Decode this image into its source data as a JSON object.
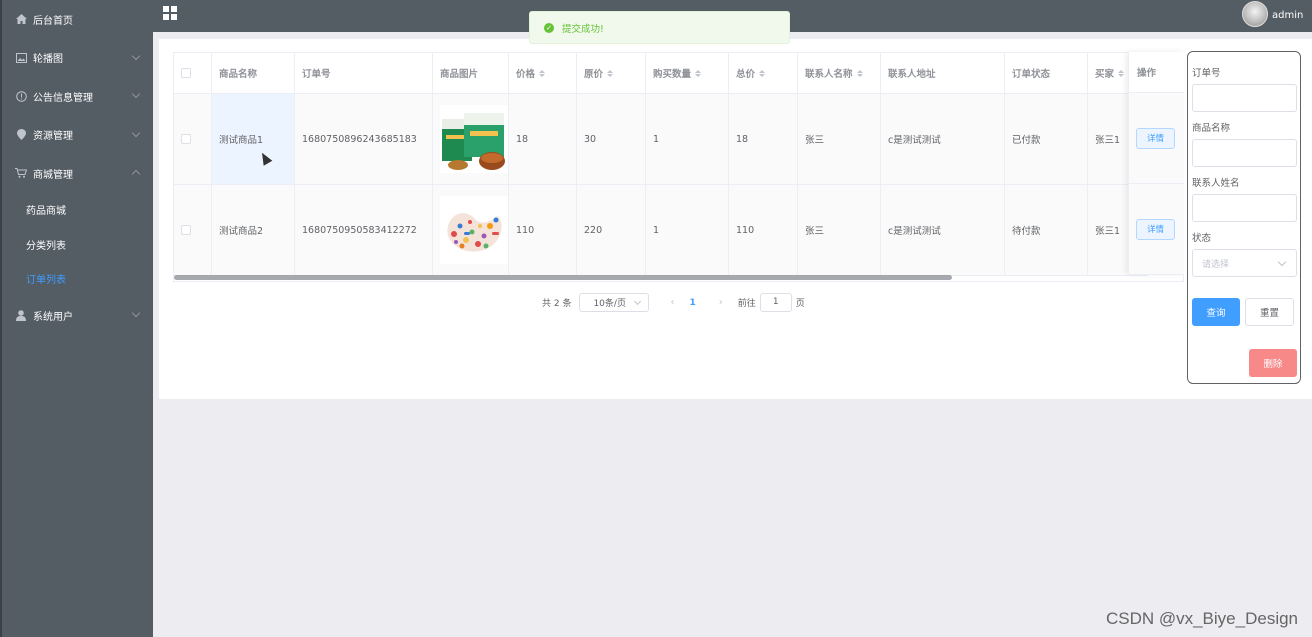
{
  "header": {
    "title": "",
    "user": "admin"
  },
  "toast": {
    "message": "提交成功!"
  },
  "sidebar": {
    "items": [
      {
        "label": "后台首页",
        "icon": "home-icon"
      },
      {
        "label": "轮播图",
        "icon": "image-icon"
      },
      {
        "label": "公告信息管理",
        "icon": "info-icon"
      },
      {
        "label": "资源管理",
        "icon": "location-icon"
      },
      {
        "label": "商城管理",
        "icon": "cart-icon"
      },
      {
        "label": "系统用户",
        "icon": "user-icon"
      }
    ],
    "subitems": [
      {
        "label": "药品商城",
        "active": false
      },
      {
        "label": "分类列表",
        "active": false
      },
      {
        "label": "订单列表",
        "active": true
      }
    ]
  },
  "table": {
    "headers": [
      "商品名称",
      "订单号",
      "商品图片",
      "价格",
      "原价",
      "购买数量",
      "总价",
      "联系人名称",
      "联系人地址",
      "订单状态",
      "买家",
      "操作"
    ],
    "rows": [
      {
        "name": "测试商品1",
        "order_no": "1680750896243685183",
        "price": "18",
        "original": "30",
        "qty": "1",
        "total": "18",
        "contact": "张三",
        "address": "c是测试测试",
        "status": "已付款",
        "buyer": "张三1",
        "action": "详情"
      },
      {
        "name": "测试商品2",
        "order_no": "1680750950583412272",
        "price": "110",
        "original": "220",
        "qty": "1",
        "total": "110",
        "contact": "张三",
        "address": "c是测试测试",
        "status": "待付款",
        "buyer": "张三1",
        "action": "详情"
      }
    ]
  },
  "pagination": {
    "total": "共 2 条",
    "page_size": "10条/页",
    "current": "1",
    "goto_prefix": "前往",
    "goto_value": "1",
    "goto_suffix": "页"
  },
  "filter": {
    "order_no_label": "订单号",
    "product_label": "商品名称",
    "contact_label": "联系人姓名",
    "status_label": "状态",
    "status_placeholder": "请选择",
    "query_label": "查询",
    "reset_label": "重置",
    "delete_label": "删除"
  },
  "watermark": "CSDN @vx_Biye_Design",
  "colors": {
    "sidebar": "#545c64",
    "primary": "#409eff",
    "success": "#67c23a",
    "danger": "#f78989"
  }
}
